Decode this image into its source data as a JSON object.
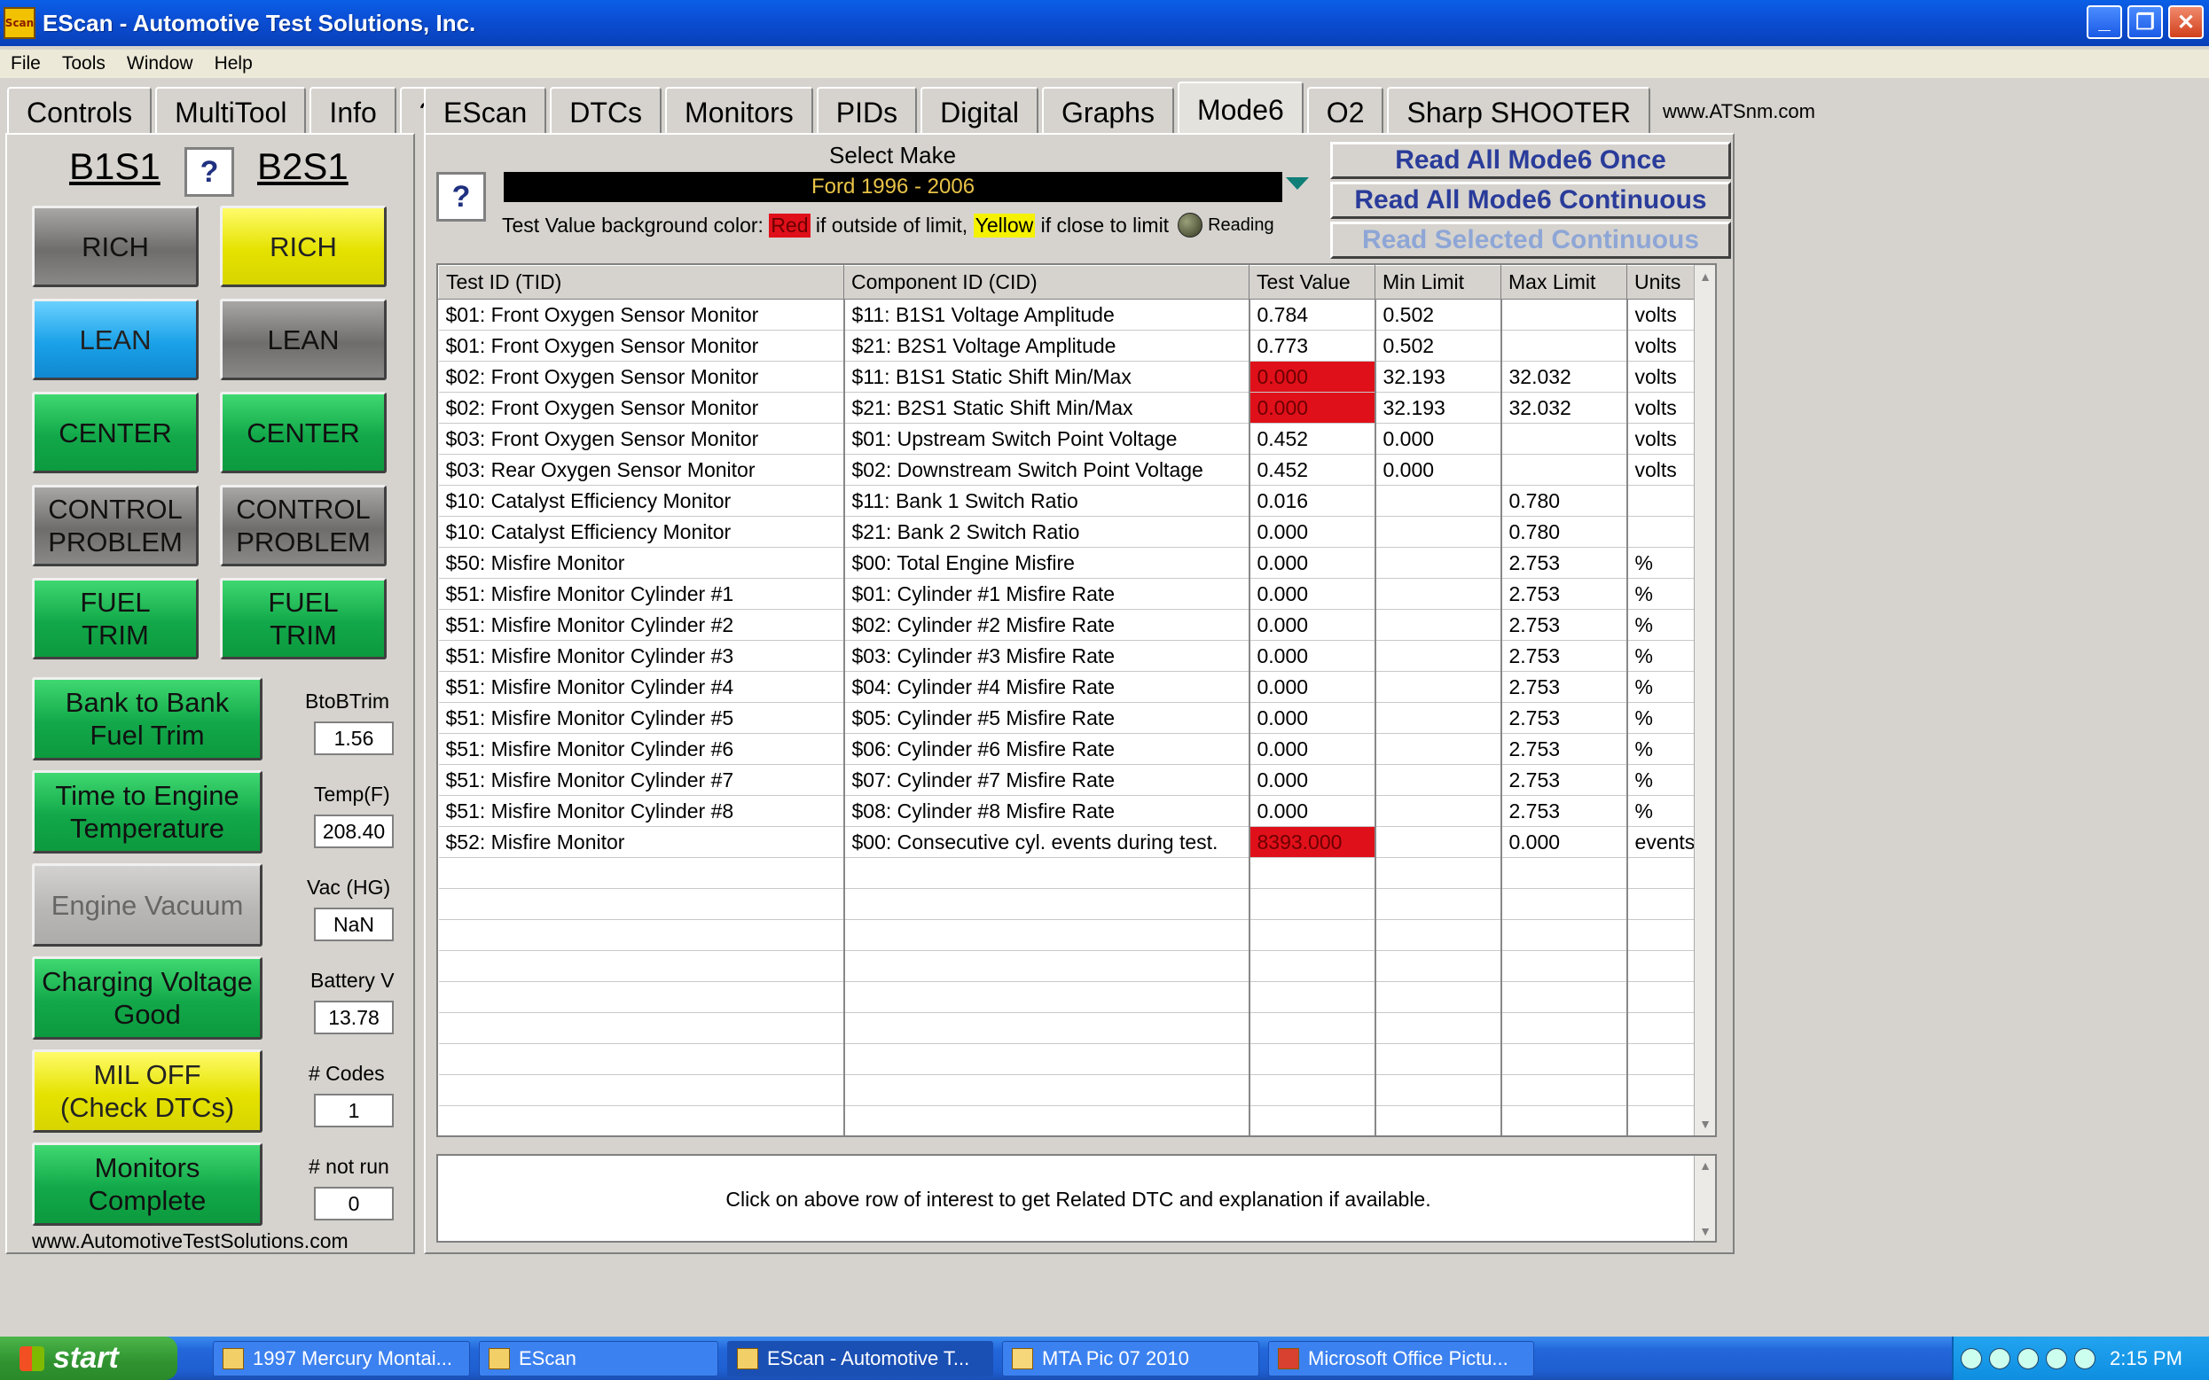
{
  "window": {
    "title": "EScan - Automotive Test Solutions, Inc.",
    "app_icon_text": "Scan",
    "minimize": "_",
    "maximize": "❐",
    "close": "✕"
  },
  "menu": [
    "File",
    "Tools",
    "Window",
    "Help"
  ],
  "left_tabs": [
    "Controls",
    "MultiTool",
    "Info",
    "?"
  ],
  "right_tabs": [
    "EScan",
    "DTCs",
    "Monitors",
    "PIDs",
    "Digital",
    "Graphs",
    "Mode6",
    "O2",
    "Sharp SHOOTER"
  ],
  "active_tab": "Mode6",
  "tab_link": "www.ATSnm.com",
  "left": {
    "b1s1": "B1S1",
    "b2s1": "B2S1",
    "help": "?",
    "indicators": {
      "b1_rich": "RICH",
      "b2_rich": "RICH",
      "b1_lean": "LEAN",
      "b2_lean": "LEAN",
      "b1_center": "CENTER",
      "b2_center": "CENTER",
      "b1_control_1": "CONTROL",
      "b1_control_2": "PROBLEM",
      "b2_control_1": "CONTROL",
      "b2_control_2": "PROBLEM",
      "b1_fuel_1": "FUEL",
      "b1_fuel_2": "TRIM",
      "b2_fuel_1": "FUEL",
      "b2_fuel_2": "TRIM"
    },
    "status": [
      {
        "line1": "Bank to Bank",
        "line2": "Fuel Trim",
        "label": "BtoBTrim",
        "value": "1.56"
      },
      {
        "line1": "Time to Engine",
        "line2": "Temperature",
        "label": "Temp(F)",
        "value": "208.40"
      },
      {
        "line1": "Engine Vacuum",
        "line2": "",
        "label": "Vac (HG)",
        "value": "NaN"
      },
      {
        "line1": "Charging Voltage",
        "line2": "Good",
        "label": "Battery V",
        "value": "13.78"
      },
      {
        "line1": "MIL OFF",
        "line2": "(Check DTCs)",
        "label": "# Codes",
        "value": "1"
      },
      {
        "line1": "Monitors",
        "line2": "Complete",
        "label": "# not run",
        "value": "0"
      }
    ],
    "url": "www.AutomotiveTestSolutions.com"
  },
  "mode6": {
    "help": "?",
    "select_make_label": "Select Make",
    "selected_make": "Ford 1996  - 2006",
    "legend_prefix": "Test Value background color:",
    "legend_red": "Red",
    "legend_mid": "if outside of limit,",
    "legend_yellow": "Yellow",
    "legend_suffix": "if close to limit",
    "legend_reading": "Reading",
    "btn_read_once": "Read All Mode6 Once",
    "btn_read_continuous": "Read All Mode6 Continuous",
    "btn_read_selected": "Read Selected Continuous",
    "columns": [
      "Test ID (TID)",
      "Component ID (CID)",
      "Test Value",
      "Min Limit",
      "Max Limit",
      "Units"
    ],
    "rows": [
      [
        "$01: Front Oxygen Sensor Monitor",
        "$11: B1S1 Voltage Amplitude",
        "0.784",
        "0.502",
        "",
        "volts"
      ],
      [
        "$01: Front Oxygen Sensor Monitor",
        "$21: B2S1 Voltage Amplitude",
        "0.773",
        "0.502",
        "",
        "volts"
      ],
      [
        "$02: Front Oxygen Sensor Monitor",
        "$11: B1S1 Static Shift Min/Max",
        "0.000",
        "32.193",
        "32.032",
        "volts"
      ],
      [
        "$02: Front Oxygen Sensor Monitor",
        "$21: B2S1 Static Shift Min/Max",
        "0.000",
        "32.193",
        "32.032",
        "volts"
      ],
      [
        "$03: Front Oxygen Sensor Monitor",
        "$01: Upstream Switch Point Voltage",
        "0.452",
        "0.000",
        "",
        "volts"
      ],
      [
        "$03: Rear Oxygen Sensor Monitor",
        "$02: Downstream Switch Point Voltage",
        "0.452",
        "0.000",
        "",
        "volts"
      ],
      [
        "$10: Catalyst Efficiency Monitor",
        "$11: Bank 1 Switch Ratio",
        "0.016",
        "",
        "0.780",
        ""
      ],
      [
        "$10: Catalyst Efficiency Monitor",
        "$21: Bank 2 Switch Ratio",
        "0.000",
        "",
        "0.780",
        ""
      ],
      [
        "$50: Misfire Monitor",
        "$00: Total Engine Misfire",
        "0.000",
        "",
        "2.753",
        "%"
      ],
      [
        "$51: Misfire Monitor Cylinder #1",
        "$01: Cylinder #1 Misfire Rate",
        "0.000",
        "",
        "2.753",
        "%"
      ],
      [
        "$51: Misfire Monitor Cylinder #2",
        "$02: Cylinder #2 Misfire Rate",
        "0.000",
        "",
        "2.753",
        "%"
      ],
      [
        "$51: Misfire Monitor Cylinder #3",
        "$03: Cylinder #3 Misfire Rate",
        "0.000",
        "",
        "2.753",
        "%"
      ],
      [
        "$51: Misfire Monitor Cylinder #4",
        "$04: Cylinder #4 Misfire Rate",
        "0.000",
        "",
        "2.753",
        "%"
      ],
      [
        "$51: Misfire Monitor Cylinder #5",
        "$05: Cylinder #5 Misfire Rate",
        "0.000",
        "",
        "2.753",
        "%"
      ],
      [
        "$51: Misfire Monitor Cylinder #6",
        "$06: Cylinder #6 Misfire Rate",
        "0.000",
        "",
        "2.753",
        "%"
      ],
      [
        "$51: Misfire Monitor Cylinder #7",
        "$07: Cylinder #7 Misfire Rate",
        "0.000",
        "",
        "2.753",
        "%"
      ],
      [
        "$51: Misfire Monitor Cylinder #8",
        "$08: Cylinder #8 Misfire Rate",
        "0.000",
        "",
        "2.753",
        "%"
      ],
      [
        "$52: Misfire Monitor",
        "$00: Consecutive cyl. events during test.",
        "8393.000",
        "",
        "0.000",
        "events"
      ]
    ],
    "red_rows": [
      2,
      3,
      17
    ],
    "message": "Click on above row of interest to get Related DTC and explanation if available."
  },
  "taskbar": {
    "start": "start",
    "items": [
      "1997 Mercury Montai...",
      "EScan",
      "EScan - Automotive T...",
      "MTA Pic 07 2010",
      "Microsoft Office Pictu..."
    ],
    "clock": "2:15 PM"
  },
  "colors": {
    "red": "#e0101a",
    "yellow": "#e5e200",
    "green": "#12a84a",
    "blue": "#1aa1e8",
    "gray": "#6f6d6b",
    "titlebar": "#0b4fd6"
  }
}
